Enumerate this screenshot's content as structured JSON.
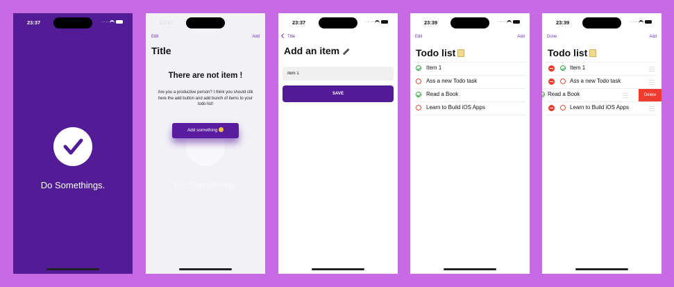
{
  "colors": {
    "background": "#c76ae3",
    "accent": "#531a98",
    "check_green": "#3aa845",
    "circle_red": "#e04a3a",
    "delete_red": "#ee3b30"
  },
  "screen1": {
    "time": "23:37",
    "splash_text": "Do Somethings.",
    "icon": "checkmark-icon"
  },
  "screen2": {
    "time": "23:37",
    "nav_left": "Edit",
    "nav_right": "Add",
    "title": "Title",
    "empty_title": "There are not item !",
    "empty_body": "Are you a productive person? I think you should clik here the add button and add bunch of items to your todo list!",
    "add_button": "Add something",
    "ghost_text": "Do Somethings"
  },
  "screen3": {
    "time": "23:37",
    "back_label": "Title",
    "title": "Add an item",
    "input_value": "Item 1",
    "save_label": "SAVE"
  },
  "screen4": {
    "time": "23:39",
    "nav_left": "Edit",
    "nav_right": "Add",
    "title": "Todo list",
    "items": [
      {
        "label": "Item 1",
        "completed": true
      },
      {
        "label": "Ass a new Todo task",
        "completed": false
      },
      {
        "label": "Read a Book",
        "completed": true
      },
      {
        "label": "Learn to Build iOS Apps",
        "completed": false
      }
    ]
  },
  "screen5": {
    "time": "23:39",
    "nav_left": "Done",
    "nav_right": "Add",
    "title": "Todo list",
    "items": [
      {
        "label": "Item 1",
        "completed": true
      },
      {
        "label": "Ass a new Todo task",
        "completed": false
      },
      {
        "label": "Read a Book",
        "completed": true
      },
      {
        "label": "Learn to Build iOS Apps",
        "completed": false
      }
    ],
    "delete_label": "Delete"
  }
}
